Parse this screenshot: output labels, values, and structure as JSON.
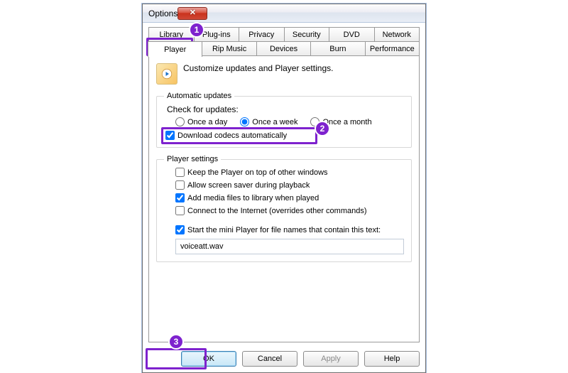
{
  "window": {
    "title": "Options"
  },
  "tabs_top": [
    "Library",
    "Plug-ins",
    "Privacy",
    "Security",
    "DVD",
    "Network"
  ],
  "tabs_bottom": [
    "Player",
    "Rip Music",
    "Devices",
    "Burn",
    "Performance"
  ],
  "active_tab": "Player",
  "intro": "Customize updates and Player settings.",
  "updates": {
    "legend": "Automatic updates",
    "check_label": "Check for updates:",
    "opts": [
      "Once a day",
      "Once a week",
      "Once a month"
    ],
    "selected": "Once a week",
    "download_codecs": {
      "label": "Download codecs automatically",
      "checked": true
    }
  },
  "player": {
    "legend": "Player settings",
    "items": [
      {
        "label": "Keep the Player on top of other windows",
        "checked": false
      },
      {
        "label": "Allow screen saver during playback",
        "checked": false
      },
      {
        "label": "Add media files to library when played",
        "checked": true
      },
      {
        "label": "Connect to the Internet (overrides other commands)",
        "checked": false
      }
    ],
    "mini": {
      "label": "Start the mini Player for file names that contain this text:",
      "checked": true
    },
    "mini_value": "voiceatt.wav"
  },
  "buttons": {
    "ok": "OK",
    "cancel": "Cancel",
    "apply": "Apply",
    "help": "Help"
  },
  "annotations": {
    "1": "1",
    "2": "2",
    "3": "3"
  }
}
